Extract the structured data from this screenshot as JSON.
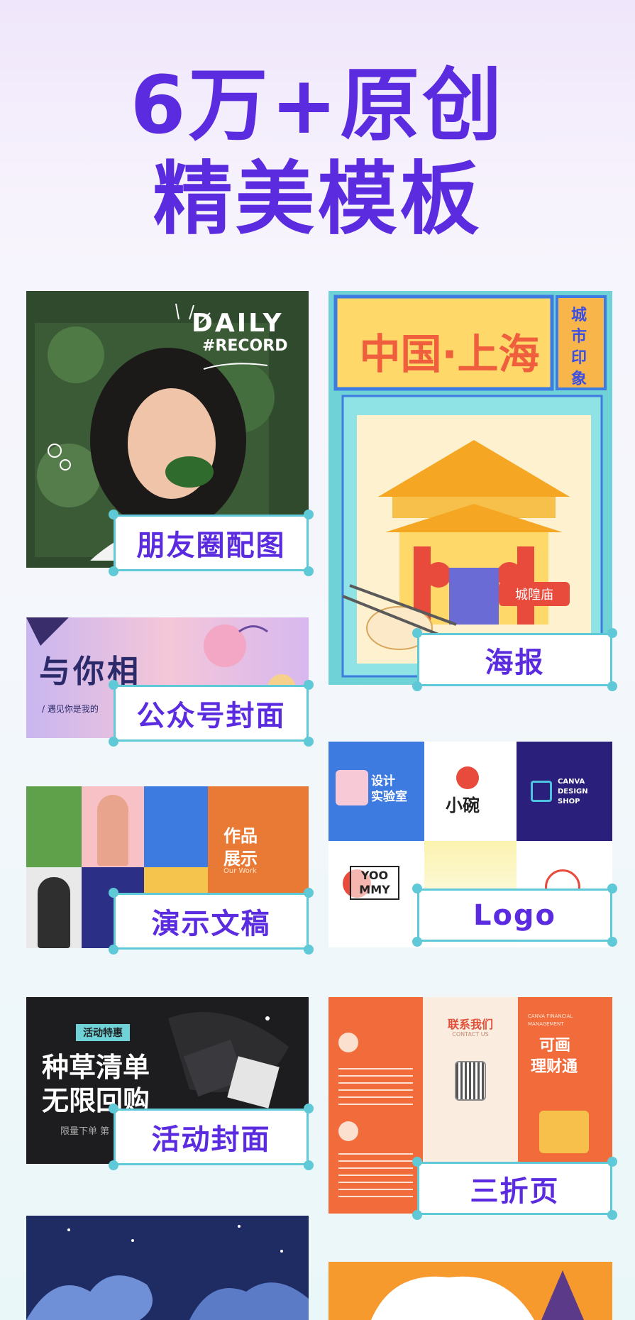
{
  "hero": {
    "line1": "6万+原创",
    "line2": "精美模板"
  },
  "cards": {
    "moments": {
      "label": "朋友圈配图",
      "art_text": [
        "DAILY",
        "#RECORD"
      ]
    },
    "poster": {
      "label": "海报",
      "title": "中国·上海",
      "side": [
        "城",
        "市",
        "印",
        "象"
      ],
      "tag": "城隍庙"
    },
    "wechat_cover": {
      "label": "公众号封面",
      "art_text": "与你相",
      "subtitle": "/ 遇见你是我的"
    },
    "logo": {
      "label": "Logo",
      "tiles": [
        "设计\n实验室",
        "小碗",
        "CANVA DESIGN SHOP",
        "YOO MMY"
      ]
    },
    "presentation": {
      "label": "演示文稿",
      "art_text": [
        "作品",
        "展示"
      ],
      "sub": "Our Work"
    },
    "tri_fold": {
      "label": "三折页",
      "contact": "联系我们",
      "contact_sub": "CONTACT US",
      "right_title": [
        "可画",
        "理财通"
      ],
      "right_brand": "CANVA FINANCIAL MANAGEMENT"
    },
    "event_cover": {
      "label": "活动封面",
      "badge": "活动特惠",
      "art_text": [
        "种草清单",
        "无限回购"
      ],
      "sub": "限量下单 第"
    }
  },
  "colors": {
    "brand_purple": "#5b2be0",
    "label_border": "#5fc9d7"
  }
}
